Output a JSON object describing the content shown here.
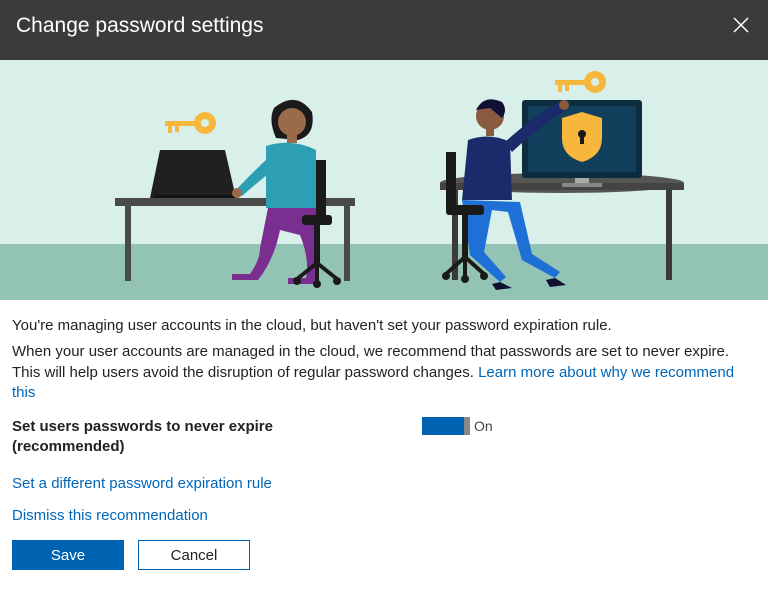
{
  "header": {
    "title": "Change password settings"
  },
  "body": {
    "intro": "You're managing user accounts in the cloud, but haven't set your password expiration rule.",
    "detail": "When your user accounts are managed in the cloud, we recommend that passwords are set to never expire. This will help users avoid the disruption of regular password changes. ",
    "learn_more": "Learn more about why we recommend this"
  },
  "toggle": {
    "label_line1": "Set users passwords to never expire",
    "label_line2": "(recommended)",
    "state": "On"
  },
  "links": {
    "different_rule": "Set a different password expiration rule",
    "dismiss": "Dismiss this recommendation"
  },
  "buttons": {
    "save": "Save",
    "cancel": "Cancel"
  }
}
